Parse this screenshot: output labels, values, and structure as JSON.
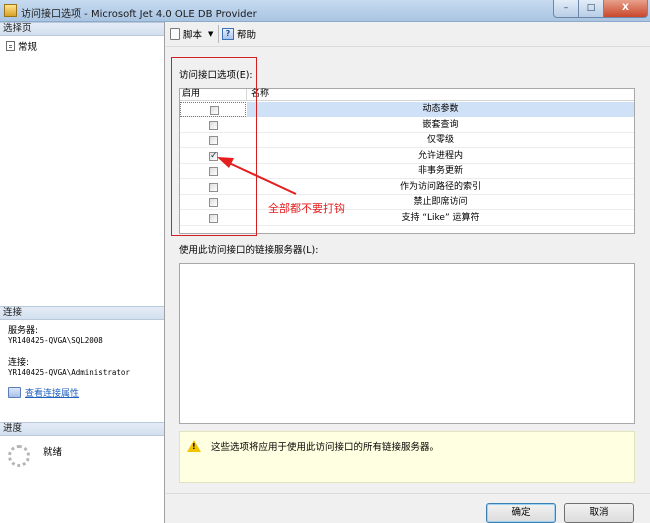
{
  "window": {
    "title": "访问接口选项 - Microsoft Jet 4.0 OLE DB Provider",
    "minimize_glyph": "–",
    "maximize_glyph": "□",
    "close_glyph": "X"
  },
  "left": {
    "select_page_header": "选择页",
    "pages": [
      {
        "label": "常规"
      }
    ],
    "connection_header": "连接",
    "server_label": "服务器:",
    "server_value": "YR140425-QVGA\\SQL2008",
    "connection_label": "连接:",
    "connection_value": "YR140425-QVGA\\Administrator",
    "view_properties_link": "查看连接属性",
    "progress_header": "进度",
    "progress_status": "就绪"
  },
  "toolbar": {
    "script_label": "脚本",
    "help_label": "帮助",
    "help_icon_glyph": "?"
  },
  "options": {
    "label": "访问接口选项(E):",
    "columns": {
      "enable": "启用",
      "name": "名称"
    },
    "rows": [
      {
        "name": "动态参数",
        "checked": false,
        "selected": true
      },
      {
        "name": "嵌套查询",
        "checked": false
      },
      {
        "name": "仅零级",
        "checked": false
      },
      {
        "name": "允许进程内",
        "checked": true
      },
      {
        "name": "非事务更新",
        "checked": false
      },
      {
        "name": "作为访问路径的索引",
        "checked": false
      },
      {
        "name": "禁止即席访问",
        "checked": false
      },
      {
        "name": "支持 “Like” 运算符",
        "checked": false
      }
    ],
    "checkmark_glyph": "✓"
  },
  "linked_servers": {
    "label": "使用此访问接口的链接服务器(L):"
  },
  "warning": {
    "text": "这些选项将应用于使用此访问接口的所有链接服务器。",
    "icon_glyph": "!"
  },
  "buttons": {
    "ok": "确定",
    "cancel": "取消"
  },
  "annotation": {
    "text": "全部都不要打钩",
    "color": "#e41e1e"
  }
}
